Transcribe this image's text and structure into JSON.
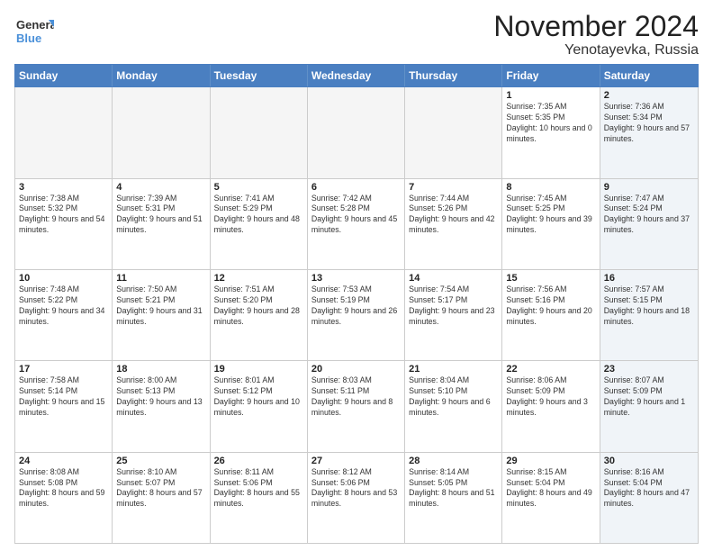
{
  "header": {
    "logo_general": "General",
    "logo_blue": "Blue",
    "month_title": "November 2024",
    "location": "Yenotayevka, Russia"
  },
  "calendar": {
    "weekdays": [
      "Sunday",
      "Monday",
      "Tuesday",
      "Wednesday",
      "Thursday",
      "Friday",
      "Saturday"
    ],
    "rows": [
      [
        {
          "day": "",
          "empty": true
        },
        {
          "day": "",
          "empty": true
        },
        {
          "day": "",
          "empty": true
        },
        {
          "day": "",
          "empty": true
        },
        {
          "day": "",
          "empty": true
        },
        {
          "day": "1",
          "sunrise": "7:35 AM",
          "sunset": "5:35 PM",
          "daylight": "10 hours and 0 minutes."
        },
        {
          "day": "2",
          "sunrise": "7:36 AM",
          "sunset": "5:34 PM",
          "daylight": "9 hours and 57 minutes.",
          "saturday": true
        }
      ],
      [
        {
          "day": "3",
          "sunrise": "7:38 AM",
          "sunset": "5:32 PM",
          "daylight": "9 hours and 54 minutes."
        },
        {
          "day": "4",
          "sunrise": "7:39 AM",
          "sunset": "5:31 PM",
          "daylight": "9 hours and 51 minutes."
        },
        {
          "day": "5",
          "sunrise": "7:41 AM",
          "sunset": "5:29 PM",
          "daylight": "9 hours and 48 minutes."
        },
        {
          "day": "6",
          "sunrise": "7:42 AM",
          "sunset": "5:28 PM",
          "daylight": "9 hours and 45 minutes."
        },
        {
          "day": "7",
          "sunrise": "7:44 AM",
          "sunset": "5:26 PM",
          "daylight": "9 hours and 42 minutes."
        },
        {
          "day": "8",
          "sunrise": "7:45 AM",
          "sunset": "5:25 PM",
          "daylight": "9 hours and 39 minutes."
        },
        {
          "day": "9",
          "sunrise": "7:47 AM",
          "sunset": "5:24 PM",
          "daylight": "9 hours and 37 minutes.",
          "saturday": true
        }
      ],
      [
        {
          "day": "10",
          "sunrise": "7:48 AM",
          "sunset": "5:22 PM",
          "daylight": "9 hours and 34 minutes."
        },
        {
          "day": "11",
          "sunrise": "7:50 AM",
          "sunset": "5:21 PM",
          "daylight": "9 hours and 31 minutes."
        },
        {
          "day": "12",
          "sunrise": "7:51 AM",
          "sunset": "5:20 PM",
          "daylight": "9 hours and 28 minutes."
        },
        {
          "day": "13",
          "sunrise": "7:53 AM",
          "sunset": "5:19 PM",
          "daylight": "9 hours and 26 minutes."
        },
        {
          "day": "14",
          "sunrise": "7:54 AM",
          "sunset": "5:17 PM",
          "daylight": "9 hours and 23 minutes."
        },
        {
          "day": "15",
          "sunrise": "7:56 AM",
          "sunset": "5:16 PM",
          "daylight": "9 hours and 20 minutes."
        },
        {
          "day": "16",
          "sunrise": "7:57 AM",
          "sunset": "5:15 PM",
          "daylight": "9 hours and 18 minutes.",
          "saturday": true
        }
      ],
      [
        {
          "day": "17",
          "sunrise": "7:58 AM",
          "sunset": "5:14 PM",
          "daylight": "9 hours and 15 minutes."
        },
        {
          "day": "18",
          "sunrise": "8:00 AM",
          "sunset": "5:13 PM",
          "daylight": "9 hours and 13 minutes."
        },
        {
          "day": "19",
          "sunrise": "8:01 AM",
          "sunset": "5:12 PM",
          "daylight": "9 hours and 10 minutes."
        },
        {
          "day": "20",
          "sunrise": "8:03 AM",
          "sunset": "5:11 PM",
          "daylight": "9 hours and 8 minutes."
        },
        {
          "day": "21",
          "sunrise": "8:04 AM",
          "sunset": "5:10 PM",
          "daylight": "9 hours and 6 minutes."
        },
        {
          "day": "22",
          "sunrise": "8:06 AM",
          "sunset": "5:09 PM",
          "daylight": "9 hours and 3 minutes."
        },
        {
          "day": "23",
          "sunrise": "8:07 AM",
          "sunset": "5:09 PM",
          "daylight": "9 hours and 1 minute.",
          "saturday": true
        }
      ],
      [
        {
          "day": "24",
          "sunrise": "8:08 AM",
          "sunset": "5:08 PM",
          "daylight": "8 hours and 59 minutes."
        },
        {
          "day": "25",
          "sunrise": "8:10 AM",
          "sunset": "5:07 PM",
          "daylight": "8 hours and 57 minutes."
        },
        {
          "day": "26",
          "sunrise": "8:11 AM",
          "sunset": "5:06 PM",
          "daylight": "8 hours and 55 minutes."
        },
        {
          "day": "27",
          "sunrise": "8:12 AM",
          "sunset": "5:06 PM",
          "daylight": "8 hours and 53 minutes."
        },
        {
          "day": "28",
          "sunrise": "8:14 AM",
          "sunset": "5:05 PM",
          "daylight": "8 hours and 51 minutes."
        },
        {
          "day": "29",
          "sunrise": "8:15 AM",
          "sunset": "5:04 PM",
          "daylight": "8 hours and 49 minutes."
        },
        {
          "day": "30",
          "sunrise": "8:16 AM",
          "sunset": "5:04 PM",
          "daylight": "8 hours and 47 minutes.",
          "saturday": true
        }
      ]
    ]
  }
}
